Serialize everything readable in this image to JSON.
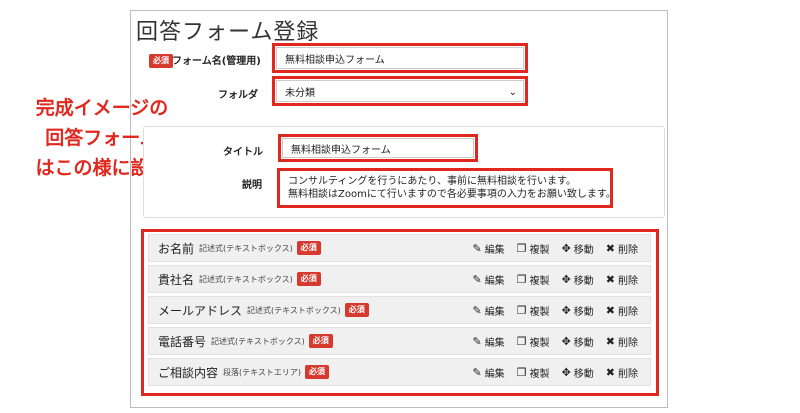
{
  "page_title": "回答フォーム登録",
  "required_badge": "必須",
  "form_name": {
    "label": "フォーム名(管理用)",
    "value": "無料相談申込フォーム"
  },
  "folder": {
    "label": "フォルダ",
    "value": "未分類",
    "chevron": "chevron-down-icon"
  },
  "annotation": [
    "完成イメージの",
    "回答フォーム",
    "はこの様に設定"
  ],
  "title_field": {
    "label": "タイトル",
    "value": "無料相談申込フォーム"
  },
  "description_field": {
    "label": "説明",
    "lines": [
      "コンサルティングを行うにあたり、事前に無料相談を行います。",
      "無料相談はZoomにて行いますので各必要事項の入力をお願い致します。"
    ]
  },
  "actions": {
    "edit": "編集",
    "copy": "複製",
    "move": "移動",
    "delete": "削除"
  },
  "items": [
    {
      "name": "お名前",
      "type": "記述式(テキストボックス)",
      "required": "必須"
    },
    {
      "name": "貴社名",
      "type": "記述式(テキストボックス)",
      "required": "必須"
    },
    {
      "name": "メールアドレス",
      "type": "記述式(テキストボックス)",
      "required": "必須"
    },
    {
      "name": "電話番号",
      "type": "記述式(テキストボックス)",
      "required": "必須"
    },
    {
      "name": "ご相談内容",
      "type": "段落(テキストエリア)",
      "required": "必須"
    }
  ],
  "colors": {
    "accent_red": "#e0281f",
    "badge_red": "#d63a2f",
    "item_bg": "#f0f0f0"
  }
}
